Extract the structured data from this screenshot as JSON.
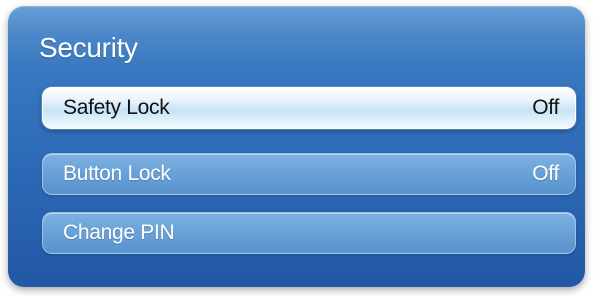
{
  "panel": {
    "title": "Security"
  },
  "menu": {
    "items": [
      {
        "label": "Safety Lock",
        "value": "Off",
        "focused": true
      },
      {
        "label": "Button Lock",
        "value": "Off",
        "focused": false
      },
      {
        "label": "Change PIN",
        "value": "",
        "focused": false
      }
    ]
  },
  "colors": {
    "panel_bg": "#2d6ab7",
    "item_bg": "#6aa2d8",
    "focused_bg": "#d9eefa"
  }
}
